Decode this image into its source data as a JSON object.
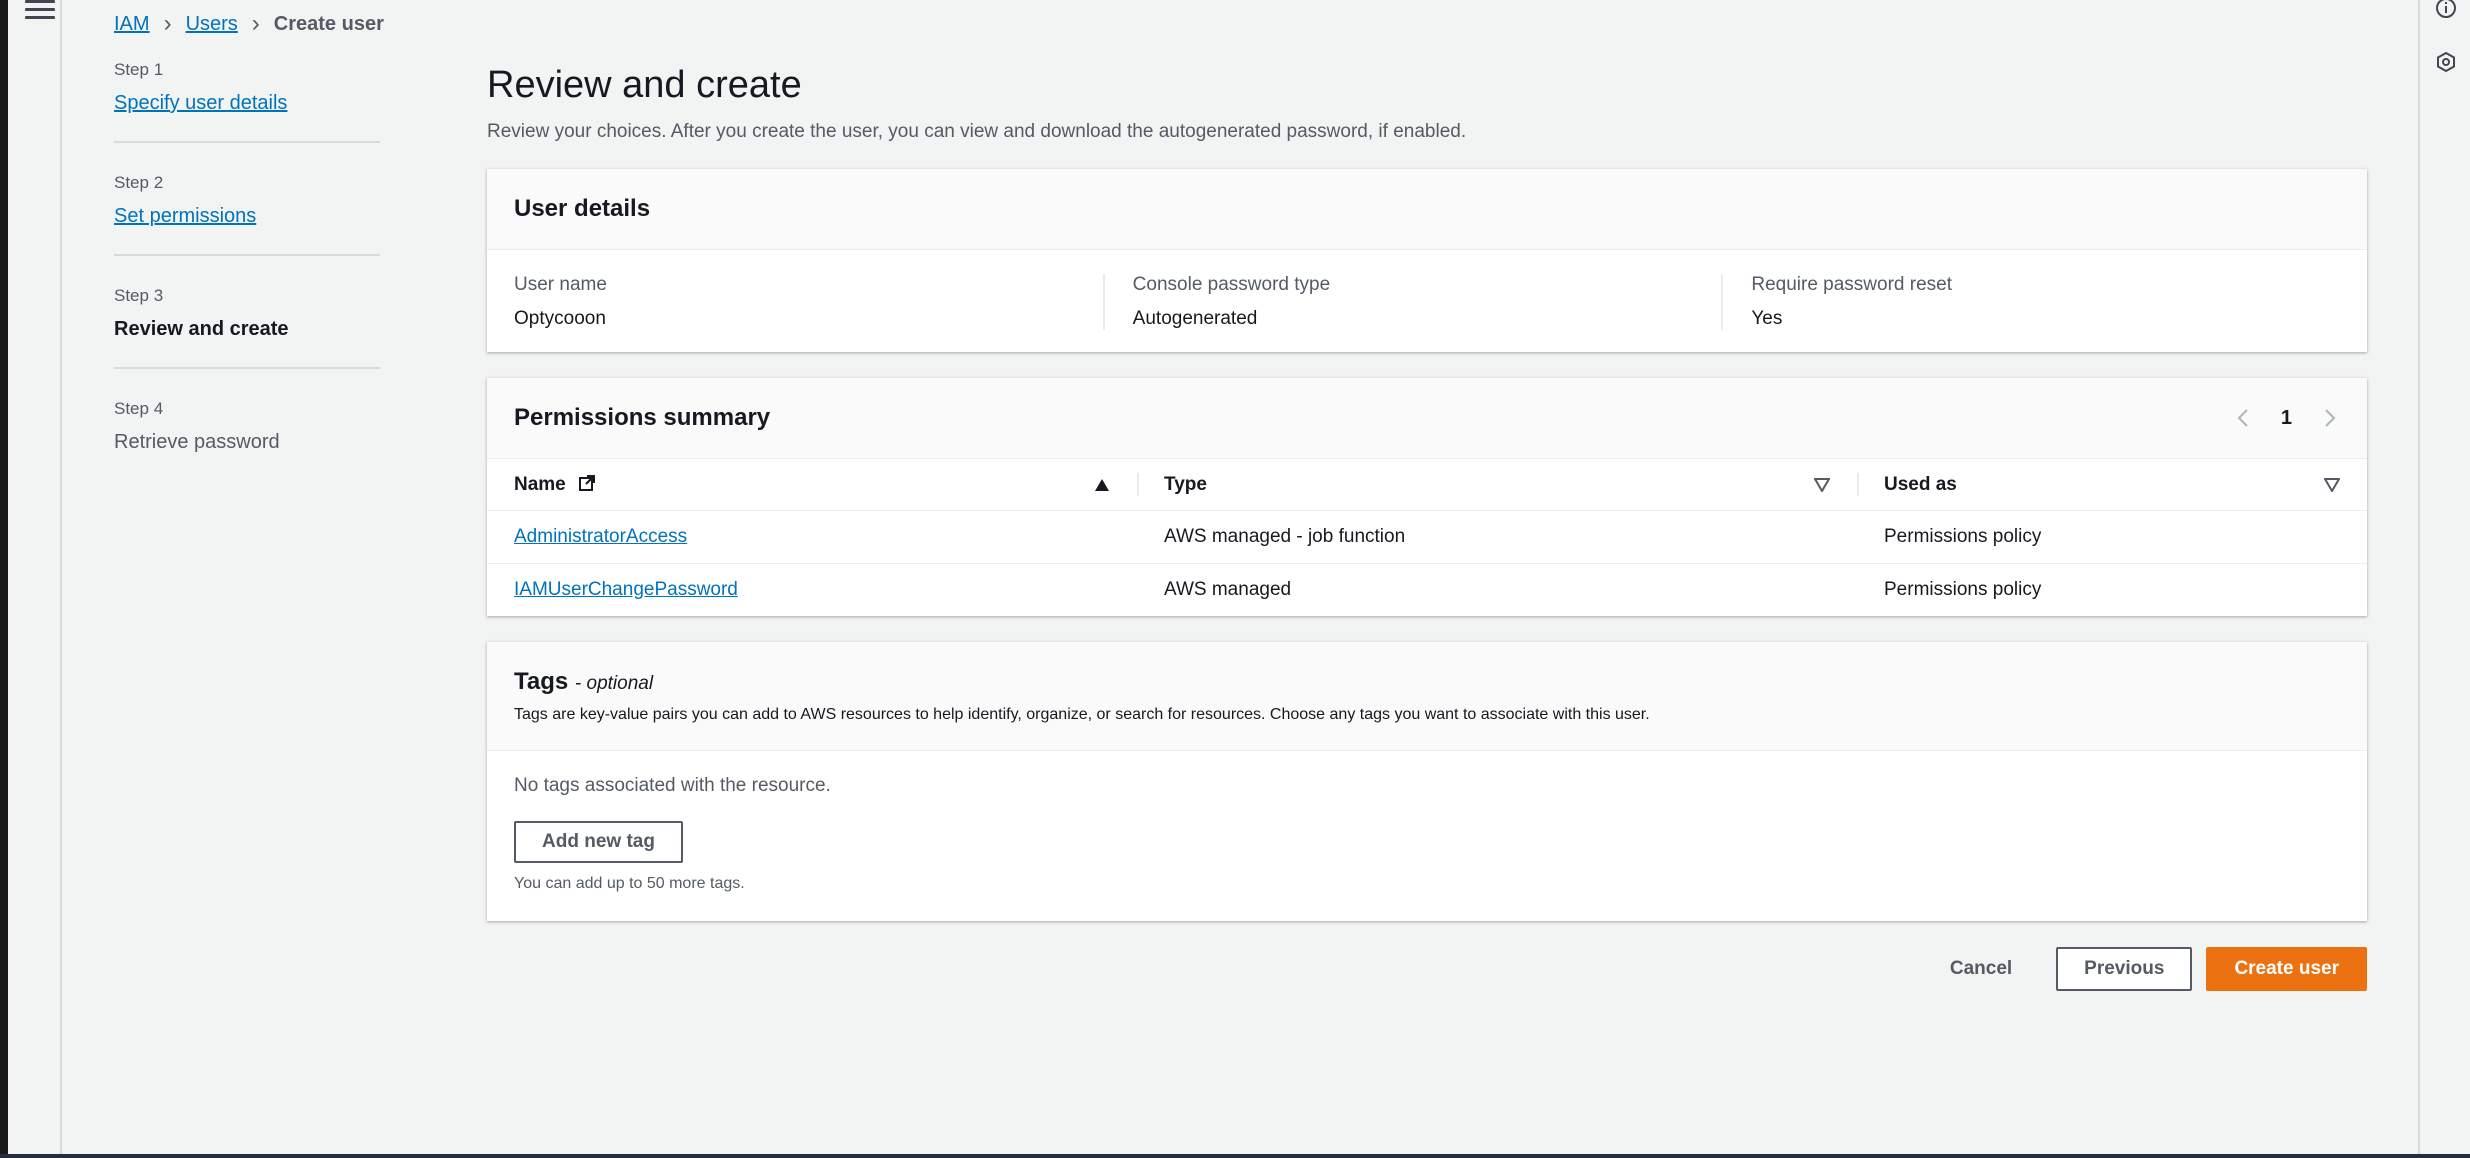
{
  "breadcrumb": {
    "items": [
      "IAM",
      "Users"
    ],
    "current": "Create user"
  },
  "steps": [
    {
      "number": "Step 1",
      "label": "Specify user details"
    },
    {
      "number": "Step 2",
      "label": "Set permissions"
    },
    {
      "number": "Step 3",
      "label": "Review and create"
    },
    {
      "number": "Step 4",
      "label": "Retrieve password"
    }
  ],
  "page": {
    "title": "Review and create",
    "description": "Review your choices. After you create the user, you can view and download the autogenerated password, if enabled."
  },
  "user_details": {
    "title": "User details",
    "fields": [
      {
        "label": "User name",
        "value": "Optycooon"
      },
      {
        "label": "Console password type",
        "value": "Autogenerated"
      },
      {
        "label": "Require password reset",
        "value": "Yes"
      }
    ]
  },
  "permissions": {
    "title": "Permissions summary",
    "page": "1",
    "columns": [
      "Name",
      "Type",
      "Used as"
    ],
    "rows": [
      {
        "name": "AdministratorAccess",
        "type": "AWS managed - job function",
        "used_as": "Permissions policy"
      },
      {
        "name": "IAMUserChangePassword",
        "type": "AWS managed",
        "used_as": "Permissions policy"
      }
    ]
  },
  "tags": {
    "title": "Tags",
    "optional": "- optional",
    "description": "Tags are key-value pairs you can add to AWS resources to help identify, organize, or search for resources. Choose any tags you want to associate with this user.",
    "empty": "No tags associated with the resource.",
    "add_button": "Add new tag",
    "limit": "You can add up to 50 more tags."
  },
  "actions": {
    "cancel": "Cancel",
    "previous": "Previous",
    "create": "Create user"
  },
  "colors": {
    "link": "#0073bb",
    "primary": "#ec7211",
    "background": "#f2f3f3"
  }
}
